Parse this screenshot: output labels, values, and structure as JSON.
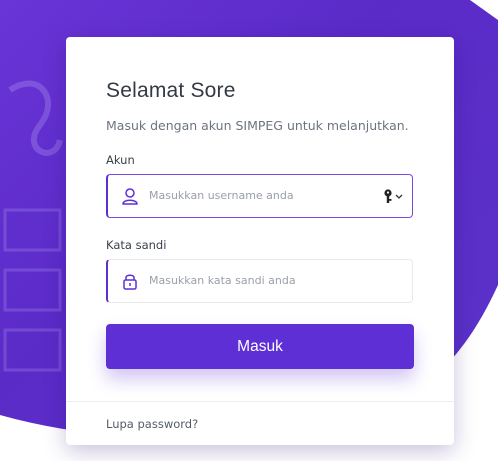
{
  "login": {
    "greeting": "Selamat Sore",
    "subtitle": "Masuk dengan akun SIMPEG untuk melanjutkan.",
    "username": {
      "label": "Akun",
      "placeholder": "Masukkan username anda",
      "icon": "user-icon",
      "option_icon": "key-icon"
    },
    "password": {
      "label": "Kata sandi",
      "placeholder": "Masukkan kata sandi anda",
      "icon": "lock-icon"
    },
    "submit_label": "Masuk",
    "forgot_label": "Lupa password?"
  },
  "colors": {
    "background_purple": "#5b2bc8",
    "accent": "#5f2fd6",
    "card": "#ffffff"
  }
}
